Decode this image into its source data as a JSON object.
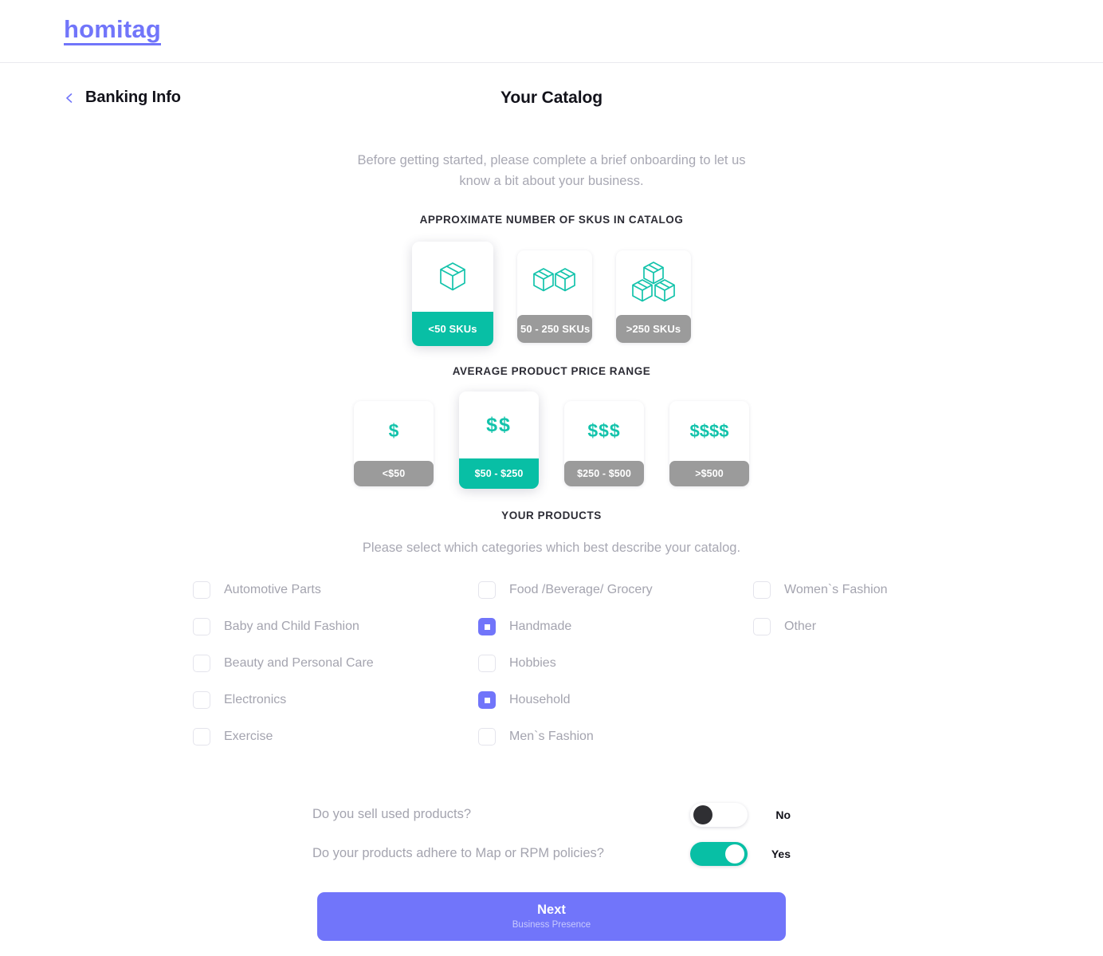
{
  "brand": {
    "logo_text": "homitag",
    "accent_purple": "#7175FA",
    "accent_teal": "#08BFA5",
    "muted_gray": "#9b9b9b"
  },
  "header": {
    "back_label": "Banking Info",
    "back_icon": "chevron-left-icon",
    "page_title": "Your Catalog"
  },
  "intro": {
    "text": "Before getting started, please complete a brief onboarding to let us know a bit about your business."
  },
  "sku_section": {
    "title": "APPROXIMATE NUMBER OF SKUS IN CATALOG",
    "options": [
      {
        "label": "<50 SKUs",
        "icon": "single-box-icon",
        "selected": true
      },
      {
        "label": "50 - 250 SKUs",
        "icon": "double-box-icon",
        "selected": false
      },
      {
        "label": ">250 SKUs",
        "icon": "triple-box-icon",
        "selected": false
      }
    ]
  },
  "price_section": {
    "title": "AVERAGE PRODUCT PRICE RANGE",
    "options": [
      {
        "label": "<$50",
        "icon": "dollar-1-icon",
        "dollars": 1,
        "selected": false
      },
      {
        "label": "$50 - $250",
        "icon": "dollar-2-icon",
        "dollars": 2,
        "selected": true
      },
      {
        "label": "$250 - $500",
        "icon": "dollar-3-icon",
        "dollars": 3,
        "selected": false
      },
      {
        "label": ">$500",
        "icon": "dollar-4-icon",
        "dollars": 4,
        "selected": false
      }
    ]
  },
  "products_section": {
    "title": "YOUR PRODUCTS",
    "help_text": "Please select which categories which best describe your catalog.",
    "columns": [
      {
        "items": [
          {
            "label": "Automotive Parts",
            "checked": false
          },
          {
            "label": "Baby and Child Fashion",
            "checked": false
          },
          {
            "label": "Beauty and Personal Care",
            "checked": false
          },
          {
            "label": "Electronics",
            "checked": false
          },
          {
            "label": "Exercise",
            "checked": false
          }
        ]
      },
      {
        "items": [
          {
            "label": "Food /Beverage/ Grocery",
            "checked": false
          },
          {
            "label": "Handmade",
            "checked": true
          },
          {
            "label": "Hobbies",
            "checked": false
          },
          {
            "label": "Household",
            "checked": true
          },
          {
            "label": "Men`s Fashion",
            "checked": false
          }
        ]
      },
      {
        "items": [
          {
            "label": "Women`s Fashion",
            "checked": false
          },
          {
            "label": "Other",
            "checked": false
          }
        ]
      }
    ]
  },
  "toggles": [
    {
      "question": "Do you sell used products?",
      "value_label": "No",
      "on": false
    },
    {
      "question": "Do your products adhere to Map or RPM policies?",
      "value_label": "Yes",
      "on": true
    }
  ],
  "next_button": {
    "label": "Next",
    "sublabel": "Business Presence"
  }
}
